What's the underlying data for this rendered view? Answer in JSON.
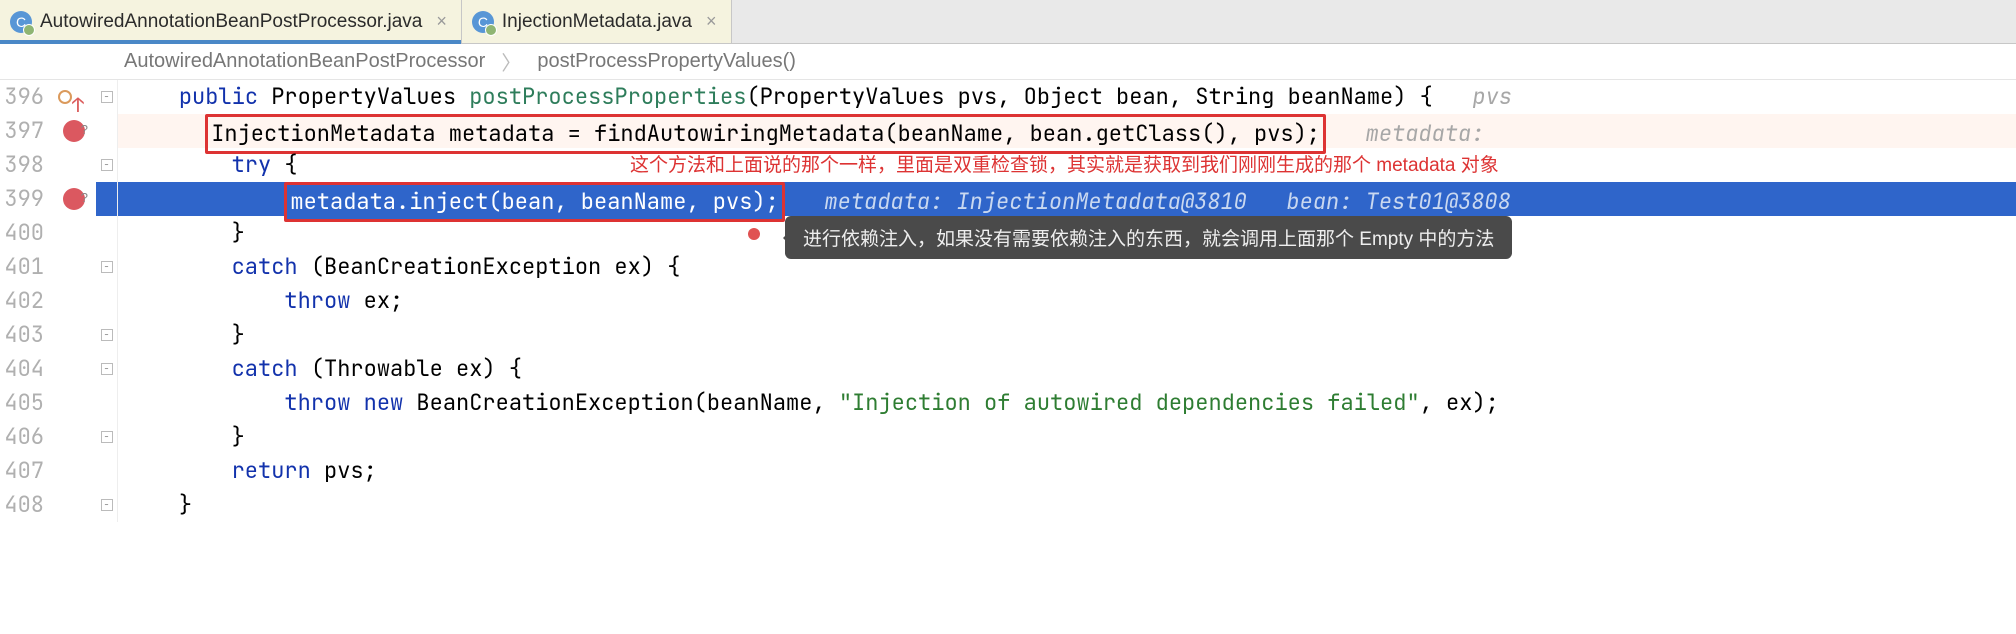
{
  "tabs": [
    {
      "label": "AutowiredAnnotationBeanPostProcessor.java",
      "active": true
    },
    {
      "label": "InjectionMetadata.java",
      "active": false
    }
  ],
  "breadcrumb": {
    "class": "AutowiredAnnotationBeanPostProcessor",
    "method": "postProcessPropertyValues()"
  },
  "lines": {
    "l396": {
      "no": "396",
      "sig_pre": "public",
      "sig_ret": "PropertyValues",
      "sig_name": "postProcessProperties",
      "sig_params": "(PropertyValues pvs, Object bean, String beanName) {",
      "hint": "pvs"
    },
    "l397": {
      "no": "397",
      "box": "InjectionMetadata metadata = findAutowiringMetadata(beanName, bean.getClass(), pvs);",
      "hint": "metadata:"
    },
    "l398": {
      "no": "398",
      "code": "try {"
    },
    "l399": {
      "no": "399",
      "box": "metadata.inject(bean, beanName, pvs);",
      "hint": "metadata: InjectionMetadata@3810   bean: Test01@3808"
    },
    "l400": {
      "no": "400",
      "code": "}"
    },
    "l401": {
      "no": "401",
      "code_pre": "catch",
      "code_post": " (BeanCreationException ex) {"
    },
    "l402": {
      "no": "402",
      "code_pre": "throw",
      "code_post": " ex;"
    },
    "l403": {
      "no": "403",
      "code": "}"
    },
    "l404": {
      "no": "404",
      "code_pre": "catch",
      "code_post": " (Throwable ex) {"
    },
    "l405": {
      "no": "405",
      "code_pre1": "throw",
      "code_pre2": "new",
      "code_mid": " BeanCreationException(beanName, ",
      "code_str": "\"Injection of autowired dependencies failed\"",
      "code_end": ", ex);"
    },
    "l406": {
      "no": "406",
      "code": "}"
    },
    "l407": {
      "no": "407",
      "code_pre": "return",
      "code_post": " pvs;"
    },
    "l408": {
      "no": "408",
      "code": "}"
    }
  },
  "annotations": {
    "top_red": "这个方法和上面说的那个一样，里面是双重检查锁，其实就是获取到我们刚刚生成的那个 metadata 对象",
    "tooltip": "进行依赖注入，如果没有需要依赖注入的东西，就会调用上面那个 Empty 中的方法"
  }
}
